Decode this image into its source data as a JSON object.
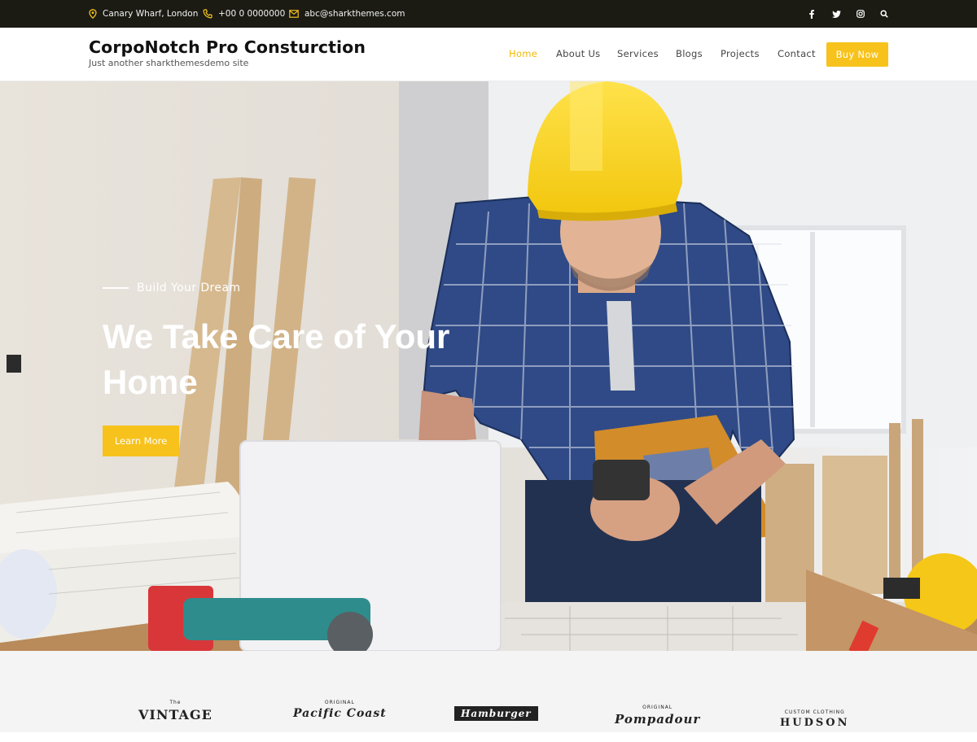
{
  "topbar": {
    "location": "Canary Wharf, London",
    "phone": "+00 0 0000000",
    "email": "abc@sharkthemes.com",
    "social_icons": [
      "facebook-icon",
      "twitter-icon",
      "instagram-icon",
      "search-icon"
    ]
  },
  "header": {
    "site_title": "CorpoNotch Pro Consturction",
    "tagline": "Just another sharkthemesdemo site",
    "nav": [
      "Home",
      "About Us",
      "Services",
      "Blogs",
      "Projects",
      "Contact"
    ],
    "active_nav": "Home",
    "buy_button": "Buy Now"
  },
  "hero": {
    "subtitle": "Build Your Dream",
    "title_line1": "We Take Care of Your",
    "title_line2": "Home",
    "button": "Learn More"
  },
  "brands": [
    {
      "top": "The",
      "name": "VINTAGE"
    },
    {
      "top": "ORIGINAL",
      "name": "Pacific Coast"
    },
    {
      "top": "",
      "name": "Hamburger"
    },
    {
      "top": "ORIGINAL",
      "name": "Pompadour"
    },
    {
      "top": "CUSTOM CLOTHING",
      "name": "HUDSON"
    }
  ],
  "colors": {
    "accent": "#f7c21c",
    "topbar_bg": "#1b1b14",
    "brands_bg": "#f4f4f4"
  }
}
